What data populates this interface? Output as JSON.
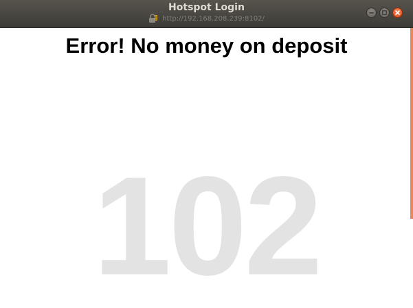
{
  "window": {
    "title": "Hotspot Login",
    "url": "http://192.168.208.239:8102/",
    "icons": [
      "lock-icon",
      "minimize-icon",
      "maximize-icon",
      "close-icon"
    ]
  },
  "page": {
    "heading": "Error! No money on deposit",
    "code": "102"
  },
  "colors": {
    "titlebar": "#4a4843",
    "close_button": "#e8582a",
    "scrollbar": "#e9875c",
    "code_watermark": "#e3e3e3"
  }
}
